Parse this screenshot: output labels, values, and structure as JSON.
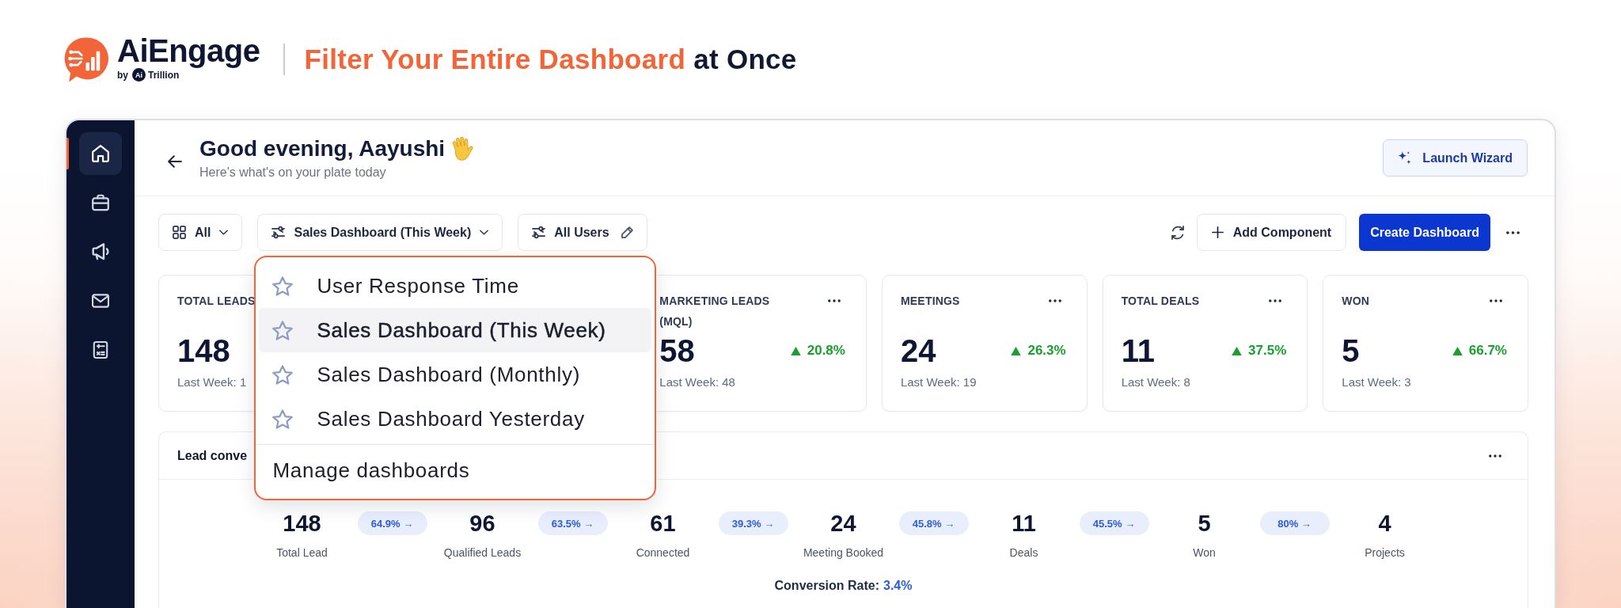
{
  "brand": {
    "name": "AiEngage",
    "byline": "by",
    "partner_mark": "Ai",
    "partner": "Trillion"
  },
  "headline": "**Filter Your Entire Dashboard** at Once",
  "sidebar": {
    "items": [
      {
        "kind": "home",
        "selected": true
      },
      {
        "kind": "briefcase",
        "selected": false
      },
      {
        "kind": "megaphone",
        "selected": false
      },
      {
        "kind": "mail",
        "selected": false
      },
      {
        "kind": "calculator",
        "selected": false
      }
    ]
  },
  "greeting": {
    "title": "Good evening, Aayushi",
    "subtitle": "Here's what's on your plate today"
  },
  "launch_button": {
    "label": "Launch Wizard"
  },
  "filters": [
    {
      "kind": "view",
      "label": "All"
    },
    {
      "kind": "dashboard",
      "label": "Sales Dashboard (This Week)",
      "menu": {
        "items": [
          {
            "label": "User Response Time",
            "selected": false
          },
          {
            "label": "Sales Dashboard (This Week)",
            "selected": true
          },
          {
            "label": "Sales Dashboard (Monthly)",
            "selected": false
          },
          {
            "label": "Sales Dashboard Yesterday",
            "selected": false
          }
        ],
        "footer": "Manage dashboards"
      }
    },
    {
      "kind": "users",
      "label": "All Users"
    }
  ],
  "toolbar": {
    "add_button": "Add Component",
    "create_button": "Create Dashboard"
  },
  "kpis": [
    {
      "title": "TOTAL LEADS",
      "value": "148",
      "previous": "Last Week: 1"
    },
    {
      "title": "MARKETING LEADS (MQL)",
      "value": "58",
      "change": {
        "kind": "increase",
        "text": "20.8%"
      },
      "previous": "Last Week: 48",
      "menu": true
    },
    {
      "title": "MEETINGS",
      "value": "24",
      "change": {
        "kind": "increase",
        "text": "26.3%"
      },
      "previous": "Last Week: 19",
      "menu": true
    },
    {
      "title": "TOTAL DEALS",
      "value": "11",
      "change": {
        "kind": "increase",
        "text": "37.5%"
      },
      "previous": "Last Week: 8",
      "menu": true
    },
    {
      "title": "WON",
      "value": "5",
      "change": {
        "kind": "increase",
        "text": "66.7%"
      },
      "previous": "Last Week: 3",
      "menu": true
    }
  ],
  "lead_conversion": {
    "title": "Lead conve",
    "stages": [
      {
        "value": "148",
        "label": "Total Lead"
      },
      {
        "value": "96",
        "label": "Qualified Leads"
      },
      {
        "value": "61",
        "label": "Connected"
      },
      {
        "value": "24",
        "label": "Meeting Booked"
      },
      {
        "value": "11",
        "label": "Deals"
      },
      {
        "value": "5",
        "label": "Won"
      },
      {
        "value": "4",
        "label": "Projects"
      }
    ],
    "rates": [
      "64.9% →",
      "63.5% →",
      "39.3% →",
      "45.8% →",
      "45.5% →",
      "80% →"
    ],
    "conversion": {
      "label": "Conversion Rate:",
      "value": "3.4%"
    }
  }
}
